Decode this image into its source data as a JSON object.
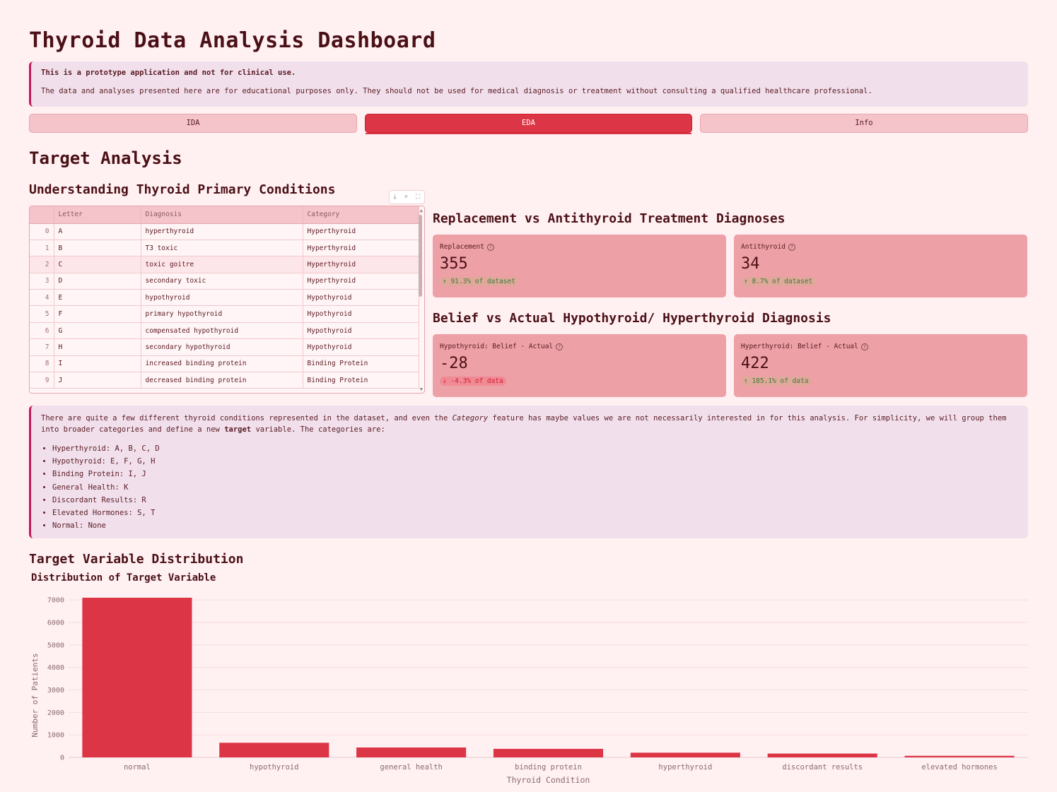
{
  "app": {
    "title": "Thyroid Data Analysis Dashboard"
  },
  "disclaimer": {
    "line1": "This is a prototype application and not for clinical use.",
    "line2": "The data and analyses presented here are for educational purposes only. They should not be used for medical diagnosis or treatment without consulting a qualified healthcare professional."
  },
  "tabs": [
    {
      "label": "IDA",
      "active": false
    },
    {
      "label": "EDA",
      "active": true
    },
    {
      "label": "Info",
      "active": false
    }
  ],
  "section": {
    "title": "Target Analysis",
    "subtitle": "Understanding Thyroid Primary Conditions"
  },
  "toolbar": {
    "download_icon": "download-icon",
    "search_icon": "search-icon",
    "fullscreen_icon": "fullscreen-icon"
  },
  "table": {
    "columns": [
      "",
      "Letter",
      "Diagnosis",
      "Category"
    ],
    "rows": [
      [
        "0",
        "A",
        "hyperthyroid",
        "Hyperthyroid"
      ],
      [
        "1",
        "B",
        "T3 toxic",
        "Hyperthyroid"
      ],
      [
        "2",
        "C",
        "toxic goitre",
        "Hyperthyroid"
      ],
      [
        "3",
        "D",
        "secondary toxic",
        "Hyperthyroid"
      ],
      [
        "4",
        "E",
        "hypothyroid",
        "Hypothyroid"
      ],
      [
        "5",
        "F",
        "primary hypothyroid",
        "Hypothyroid"
      ],
      [
        "6",
        "G",
        "compensated hypothyroid",
        "Hypothyroid"
      ],
      [
        "7",
        "H",
        "secondary hypothyroid",
        "Hypothyroid"
      ],
      [
        "8",
        "I",
        "increased binding protein",
        "Binding Protein"
      ],
      [
        "9",
        "J",
        "decreased binding protein",
        "Binding Protein"
      ]
    ]
  },
  "treatment": {
    "title": "Replacement vs Antithyroid Treatment Diagnoses",
    "metrics": [
      {
        "label": "Replacement",
        "value": "355",
        "delta": "91.3% of dataset",
        "direction": "up"
      },
      {
        "label": "Antithyroid",
        "value": "34",
        "delta": "8.7% of dataset",
        "direction": "up"
      }
    ]
  },
  "belief": {
    "title": "Belief vs Actual Hypothyroid/ Hyperthyroid Diagnosis",
    "metrics": [
      {
        "label": "Hypothyroid: Belief - Actual",
        "value": "-28",
        "delta": "-4.3% of data",
        "direction": "down"
      },
      {
        "label": "Hyperthyroid: Belief - Actual",
        "value": "422",
        "delta": "185.1% of data",
        "direction": "up"
      }
    ]
  },
  "info": {
    "text_before": "There are quite a few different thyroid conditions represented in the dataset, and even the ",
    "text_italic": "Category",
    "text_middle": " feature has maybe values we are not necessarily interested in for this analysis. For simplicity, we will group them into broader categories and define a new ",
    "text_bold": "target",
    "text_after": " variable. The categories are:",
    "items": [
      "Hyperthyroid: A, B, C, D",
      "Hypothyroid: E, F, G, H",
      "Binding Protein: I, J",
      "General Health: K",
      "Discordant Results: R",
      "Elevated Hormones: S, T",
      "Normal: None"
    ]
  },
  "distribution": {
    "title": "Target Variable Distribution"
  },
  "chart_data": {
    "type": "bar",
    "title": "Distribution of Target Variable",
    "xlabel": "Thyroid Condition",
    "ylabel": "Number of Patients",
    "categories": [
      "normal",
      "hypothyroid",
      "general health",
      "binding protein",
      "hyperthyroid",
      "discordant results",
      "elevated hormones"
    ],
    "values": [
      7100,
      650,
      440,
      380,
      210,
      170,
      70
    ],
    "ylim": [
      0,
      7100
    ],
    "yticks": [
      0,
      1000,
      2000,
      3000,
      4000,
      5000,
      6000,
      7000
    ],
    "grid": true,
    "color": "#dc3545"
  }
}
